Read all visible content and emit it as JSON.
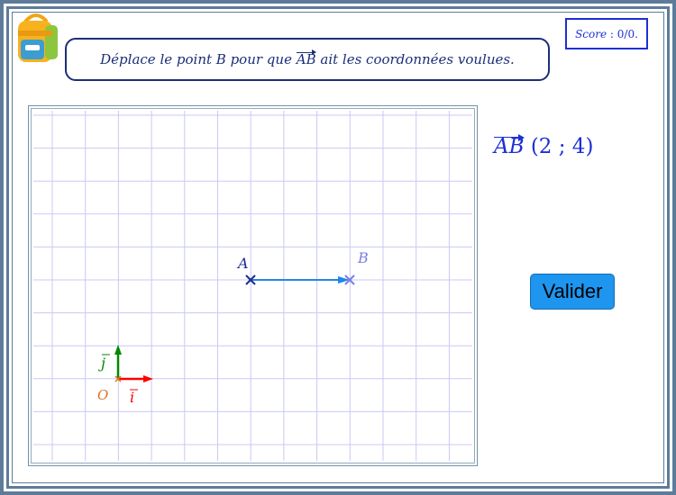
{
  "instruction": {
    "before": "Déplace le point B pour que ",
    "vector": "AB",
    "after": " ait les coordonnées voulues."
  },
  "score": {
    "label": "Score",
    "separator": " : ",
    "value": "0/0."
  },
  "target": {
    "vector": "AB",
    "coords": "(2 ; 4)"
  },
  "validate_button": "Valider",
  "graph": {
    "point_a": "A",
    "point_b": "B",
    "origin": "O",
    "unit_i": "i",
    "unit_j": "j",
    "colors": {
      "grid": "#c9c9f4",
      "point_a": "#1c2e90",
      "point_b": "#7d7de8",
      "vector": "#1e88e5",
      "i": "#ff0000",
      "j": "#008800",
      "origin": "#e07020"
    }
  }
}
